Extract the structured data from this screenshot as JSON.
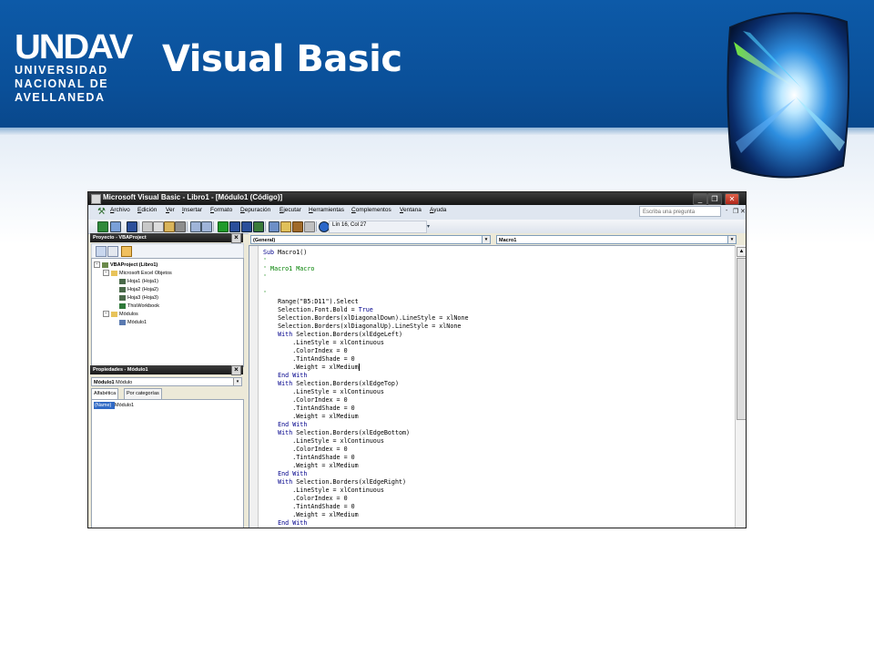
{
  "slide": {
    "title": "Visual Basic",
    "logo": {
      "mark": "UNDAV",
      "line1": "UNIVERSIDAD",
      "line2": "NACIONAL DE",
      "line3": "AVELLANEDA"
    },
    "header_color": "#0b52a0"
  },
  "window": {
    "title": "Microsoft Visual Basic - Libro1 - [Módulo1 (Código)]",
    "controls": {
      "minimize": "_",
      "restore": "❐",
      "close": "✕"
    }
  },
  "menubar": {
    "items": [
      "Archivo",
      "Edición",
      "Ver",
      "Insertar",
      "Formato",
      "Depuración",
      "Ejecutar",
      "Herramientas",
      "Complementos",
      "Ventana",
      "Ayuda"
    ],
    "help_placeholder": "Escriba una pregunta",
    "doc_controls": [
      "-",
      "❐",
      "✕"
    ]
  },
  "toolbar": {
    "cursor_position": "Lín 16, Col 27"
  },
  "project_pane": {
    "title": "Proyecto - VBAProject",
    "tree": {
      "root": "VBAProject (Libro1)",
      "excel_objects": "Microsoft Excel Objetos",
      "sheets": [
        "Hoja1 (Hoja1)",
        "Hoja2 (Hoja2)",
        "Hoja3 (Hoja3)",
        "ThisWorkbook"
      ],
      "modules": "Módulos",
      "module1": "Módulo1"
    }
  },
  "properties_pane": {
    "title": "Propiedades - Módulo1",
    "object_name": "Módulo1",
    "object_type": "Módulo",
    "tabs": [
      "Alfabética",
      "Por categorías"
    ],
    "property_name": "(Name)",
    "property_value": "Módulo1"
  },
  "code_pane": {
    "object_combo": "(General)",
    "procedure_combo": "Macro1",
    "lines": [
      "Sub Macro1()",
      "'",
      "' Macro1 Macro",
      "'",
      "",
      "'",
      "    Range(\"B5:D11\").Select",
      "    Selection.Font.Bold = True",
      "    Selection.Borders(xlDiagonalDown).LineStyle = xlNone",
      "    Selection.Borders(xlDiagonalUp).LineStyle = xlNone",
      "    With Selection.Borders(xlEdgeLeft)",
      "        .LineStyle = xlContinuous",
      "        .ColorIndex = 0",
      "        .TintAndShade = 0",
      "        .Weight = xlMedium",
      "    End With",
      "    With Selection.Borders(xlEdgeTop)",
      "        .LineStyle = xlContinuous",
      "        .ColorIndex = 0",
      "        .TintAndShade = 0",
      "        .Weight = xlMedium",
      "    End With",
      "    With Selection.Borders(xlEdgeBottom)",
      "        .LineStyle = xlContinuous",
      "        .ColorIndex = 0",
      "        .TintAndShade = 0",
      "        .Weight = xlMedium",
      "    End With",
      "    With Selection.Borders(xlEdgeRight)",
      "        .LineStyle = xlContinuous",
      "        .ColorIndex = 0",
      "        .TintAndShade = 0",
      "        .Weight = xlMedium",
      "    End With"
    ]
  }
}
